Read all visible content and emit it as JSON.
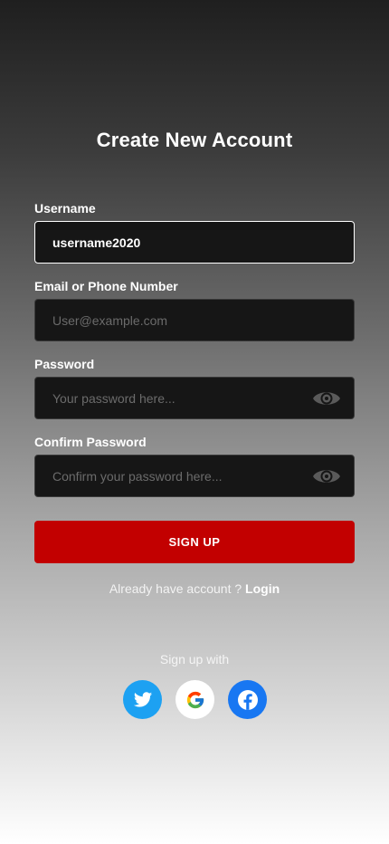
{
  "title": "Create New Account",
  "fields": {
    "username": {
      "label": "Username",
      "value": "username2020",
      "placeholder": ""
    },
    "email": {
      "label": "Email or Phone Number",
      "value": "",
      "placeholder": "User@example.com"
    },
    "password": {
      "label": "Password",
      "value": "",
      "placeholder": "Your password here..."
    },
    "confirm": {
      "label": "Confirm Password",
      "value": "",
      "placeholder": "Confirm your password here..."
    }
  },
  "signup_button": "SIGN UP",
  "login_prompt": "Already have account ?",
  "login_link": "Login",
  "signup_with": "Sign up with",
  "icons": {
    "eye": "eye-icon",
    "twitter": "twitter-icon",
    "google": "google-icon",
    "facebook": "facebook-icon"
  },
  "colors": {
    "accent": "#c20000",
    "twitter": "#1da1f2",
    "facebook": "#1877f2",
    "field_bg": "#161616"
  }
}
